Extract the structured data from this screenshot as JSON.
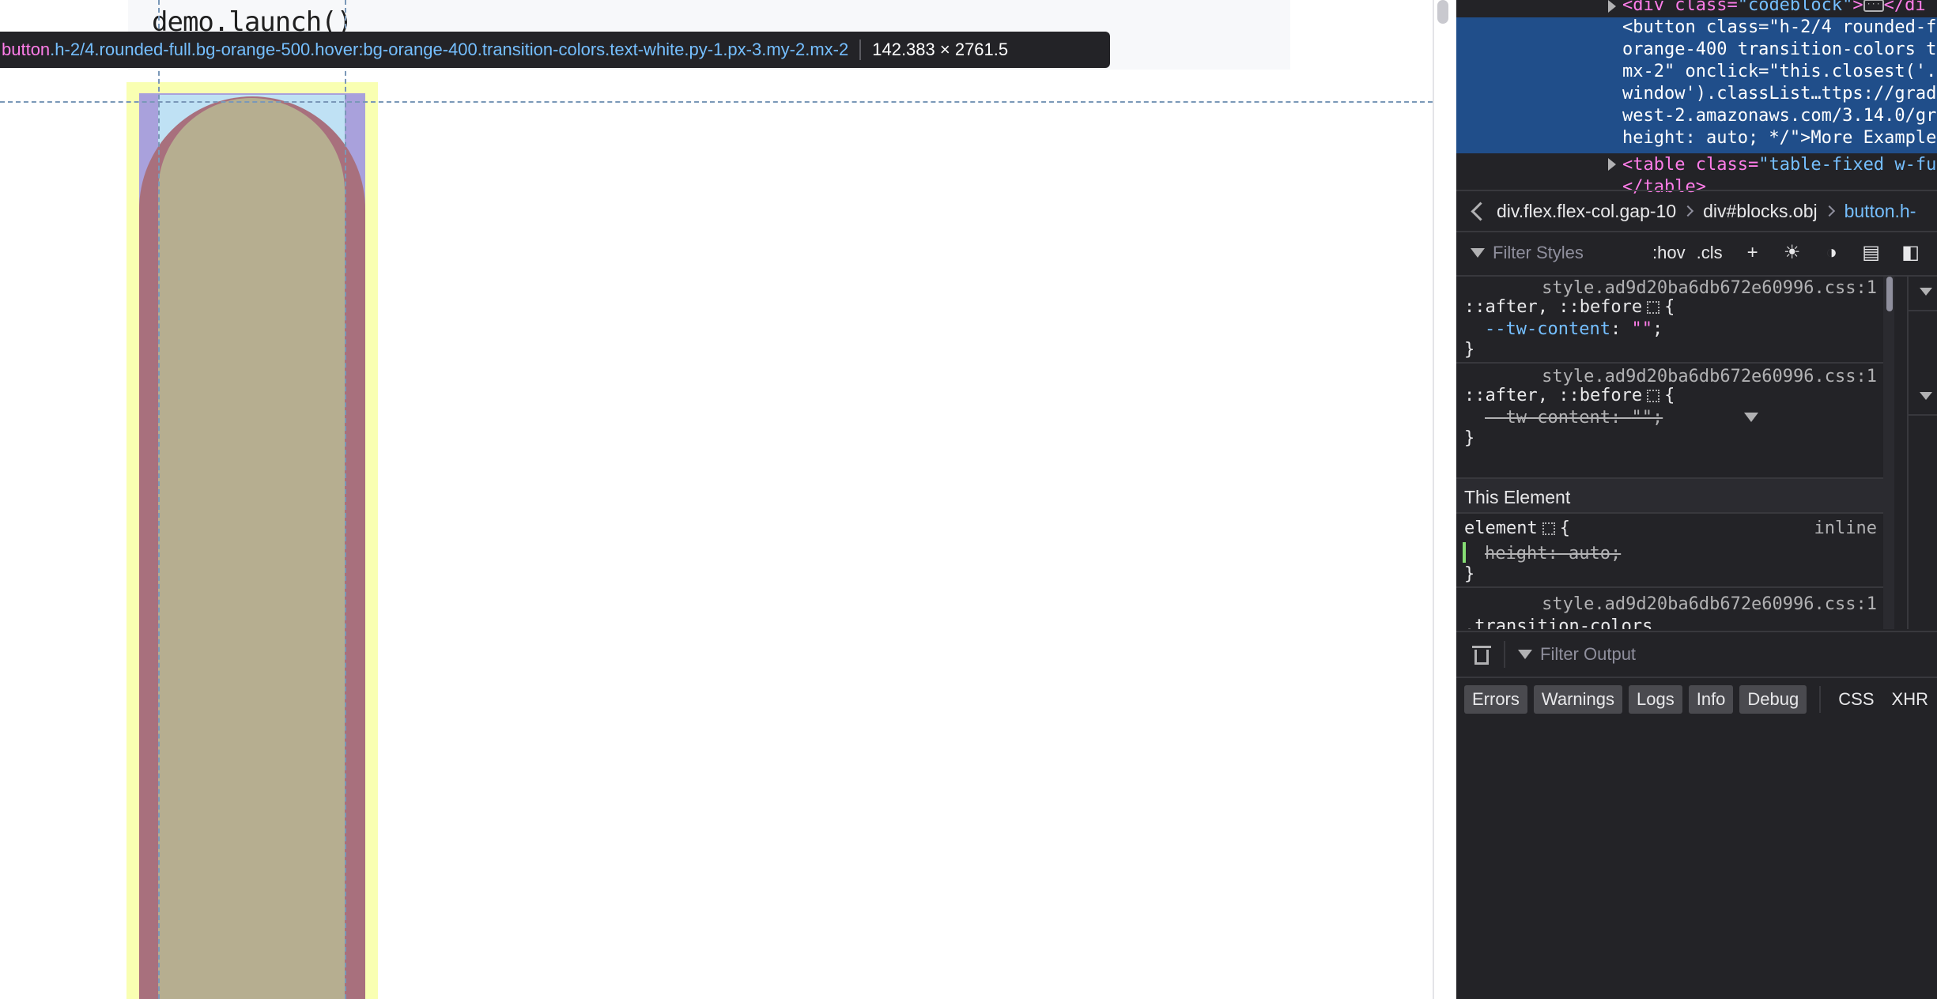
{
  "page": {
    "code_text": "demo.launch()"
  },
  "highlighter": {
    "selector_tag": "button",
    "selector_classes": ".h-2/4.rounded-full.bg-orange-500.hover:bg-orange-400.transition-colors.text-white.py-1.px-3.my-2.mx-2",
    "dimensions": "142.383 × 2761.5"
  },
  "markup": {
    "line0": {
      "tag": "<div",
      "attr": " class=",
      "val": "\"codeblock\"",
      "close": "></di"
    },
    "selected_lines": [
      "<button class=\"h-2/4 rounded-f",
      "orange-400 transition-colors t",
      "mx-2\" onclick=\"this.closest('.",
      "window').classList…ttps://grad",
      "west-2.amazonaws.com/3.14.0/gr",
      "height: auto; */\">More Example"
    ],
    "table_line": {
      "tag": "<table",
      "attr": " class=",
      "val": "\"table-fixed w-fu"
    },
    "table_close": "</table>"
  },
  "breadcrumbs": [
    "div.flex.flex-col.gap-10",
    "div#blocks.obj",
    "button.h-"
  ],
  "styles_toolbar": {
    "filter_placeholder": "Filter Styles",
    "hov": ":hov",
    "cls": ".cls",
    "plus": "+"
  },
  "rules": {
    "rule1": {
      "source": "style.ad9d20ba6db672e60996.css:1",
      "selector": "::after, ::before",
      "prop": "--tw-content",
      "value": "\"\""
    },
    "rule2": {
      "source": "style.ad9d20ba6db672e60996.css:1",
      "selector": "::after, ::before",
      "prop": "--tw-content",
      "value": "\"\""
    },
    "section_title": "This Element",
    "element_rule": {
      "selector": "element",
      "source": "inline",
      "prop": "height",
      "value": "auto"
    },
    "rule4": {
      "source": "style.ad9d20ba6db672e60996.css:1",
      "selector_partial": ".transition-colors"
    },
    "open_brace": "{",
    "close_brace": "}"
  },
  "console": {
    "filter_placeholder": "Filter Output",
    "levels": [
      "Errors",
      "Warnings",
      "Logs",
      "Info",
      "Debug"
    ],
    "extra": [
      "CSS",
      "XHR"
    ]
  },
  "colors": {
    "margin_overlay": "#f9ffb2",
    "padding_overlay": "#a9a1dc",
    "content_overlay": "#bfe1f4",
    "button_fill": "#a8707d",
    "devtools_bg": "#232327",
    "selection_blue": "#204e8a"
  }
}
